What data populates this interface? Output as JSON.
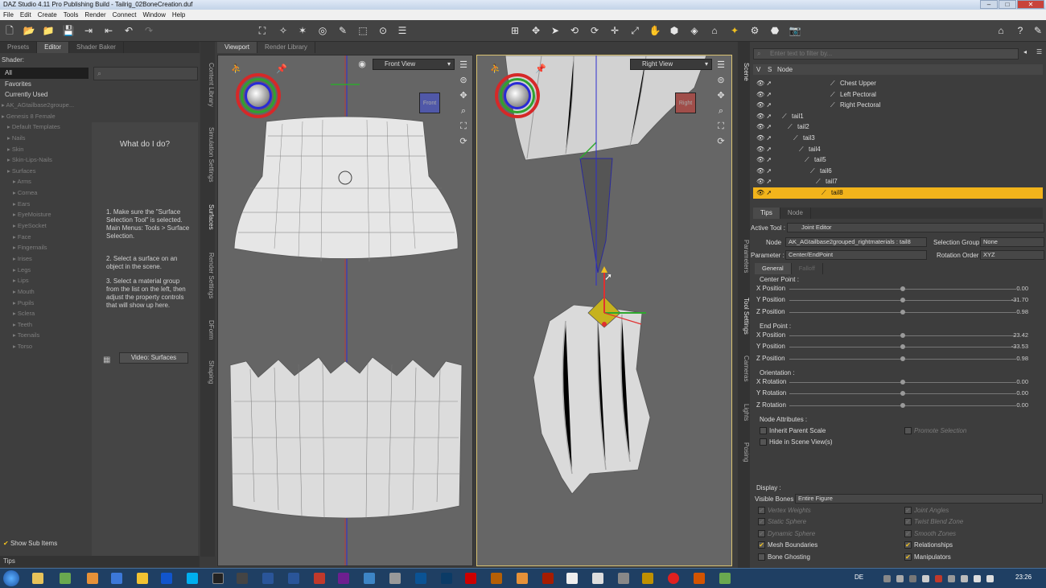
{
  "window": {
    "title": "DAZ Studio 4.11 Pro Publishing Build - Tailrig_02BoneCreation.duf"
  },
  "menu": [
    "File",
    "Edit",
    "Create",
    "Tools",
    "Render",
    "Connect",
    "Window",
    "Help"
  ],
  "left": {
    "tabs": [
      "Presets",
      "Editor",
      "Shader Baker"
    ],
    "shader_label": "Shader:",
    "filters": [
      "All",
      "Favorites",
      "Currently Used"
    ],
    "tree": [
      "AK_AGtailbase2groupe...",
      "Genesis 8 Female",
      "Default Templates",
      "Nails",
      "Skin",
      "Skin-Lips-Nails",
      "Surfaces",
      "Arms",
      "Cornea",
      "Ears",
      "EyeMoisture",
      "EyeSocket",
      "Face",
      "Fingernails",
      "Irises",
      "Legs",
      "Lips",
      "Mouth",
      "Pupils",
      "Sclera",
      "Teeth",
      "Toenails",
      "Torso"
    ],
    "help_title": "What do I do?",
    "steps": [
      "1. Make sure the \"Surface Selection Tool\" is selected. Main Menus: Tools > Surface Selection.",
      "2. Select a surface on an object in the scene.",
      "3. Select a material group from the list on the left, then adjust the property controls that will show up here."
    ],
    "video_button": "Video: Surfaces",
    "show_sub": "Show Sub Items",
    "tips": "Tips"
  },
  "side_tabs": [
    "Content Library",
    "Simulation Settings",
    "Surfaces",
    "Render Settings",
    "DForm",
    "Shaping"
  ],
  "viewport": {
    "tabs": [
      "Viewport",
      "Render Library"
    ],
    "left_view": "Front View",
    "right_view": "Right View",
    "left_cube": "Front",
    "right_cube": "Right"
  },
  "right_side_tabs": [
    "Scene",
    "Parameters",
    "Tool Settings",
    "Cameras",
    "Lights",
    "Posing"
  ],
  "scene": {
    "filter_placeholder": "Enter text to filter by...",
    "cols": [
      "V",
      "S",
      "Node"
    ],
    "rows": [
      {
        "label": "Chest Upper",
        "indent": 3,
        "sel": false
      },
      {
        "label": "Left Pectoral",
        "indent": 3,
        "sel": false
      },
      {
        "label": "Right Pectoral",
        "indent": 3,
        "sel": false
      },
      {
        "label": "tail1",
        "indent": 0,
        "sel": false
      },
      {
        "label": "tail2",
        "indent": 1,
        "sel": false
      },
      {
        "label": "tail3",
        "indent": 2,
        "sel": false
      },
      {
        "label": "tail4",
        "indent": 3,
        "sel": false
      },
      {
        "label": "tail5",
        "indent": 4,
        "sel": false
      },
      {
        "label": "tail6",
        "indent": 5,
        "sel": false
      },
      {
        "label": "tail7",
        "indent": 6,
        "sel": false
      },
      {
        "label": "tail8",
        "indent": 7,
        "sel": true
      }
    ]
  },
  "tool": {
    "tabs": [
      "Tips",
      "Node"
    ],
    "active_tool_label": "Active Tool :",
    "active_tool": "Joint Editor",
    "node_label": "Node",
    "node_value": "AK_AGtailbase2grouped_rightmaterials : tail8",
    "selgroup_label": "Selection Group :",
    "selgroup_value": "None",
    "param_label": "Parameter :",
    "param_value": "Center/EndPoint",
    "rotorder_label": "Rotation Order :",
    "rotorder_value": "XYZ",
    "subtabs": [
      "General",
      "Falloff"
    ],
    "center_label": "Center Point :",
    "end_label": "End Point :",
    "orient_label": "Orientation :",
    "sliders": [
      {
        "label": "X Position",
        "value": "0.00",
        "level": 0.5
      },
      {
        "label": "Y Position",
        "value": "-31.70",
        "level": 0.5
      },
      {
        "label": "Z Position",
        "value": "0.98",
        "level": 0.5
      },
      {
        "label": "X Position",
        "value": "23.42",
        "level": 0.5
      },
      {
        "label": "Y Position",
        "value": "-33.53",
        "level": 0.5
      },
      {
        "label": "Z Position",
        "value": "0.98",
        "level": 0.5
      },
      {
        "label": "X Rotation",
        "value": "0.00",
        "level": 0.5
      },
      {
        "label": "Y Rotation",
        "value": "0.00",
        "level": 0.5
      },
      {
        "label": "Z Rotation",
        "value": "0.00",
        "level": 0.5
      }
    ],
    "attrs_label": "Node Attributes :",
    "inherit": "Inherit Parent Scale",
    "promote": "Promote Selection",
    "hide": "Hide in Scene View(s)",
    "display_label": "Display :",
    "visible_bones_label": "Visible Bones :",
    "visible_bones_value": "Entire Figure",
    "display_left": [
      {
        "label": "Vertex Weights",
        "on": true,
        "dim": true
      },
      {
        "label": "Static Sphere",
        "on": true,
        "dim": true
      },
      {
        "label": "Dynamic Sphere",
        "on": true,
        "dim": true
      },
      {
        "label": "Mesh Boundaries",
        "on": true,
        "dim": false
      },
      {
        "label": "Bone Ghosting",
        "on": false,
        "dim": false
      }
    ],
    "display_right": [
      {
        "label": "Joint Angles",
        "on": true,
        "dim": true
      },
      {
        "label": "Twist Blend Zone",
        "on": true,
        "dim": true
      },
      {
        "label": "Smooth Zones",
        "on": true,
        "dim": true
      },
      {
        "label": "Relationships",
        "on": true,
        "dim": false
      },
      {
        "label": "Manipulators",
        "on": true,
        "dim": false
      }
    ]
  },
  "taskbar": {
    "lang": "DE",
    "time": "23:26"
  }
}
